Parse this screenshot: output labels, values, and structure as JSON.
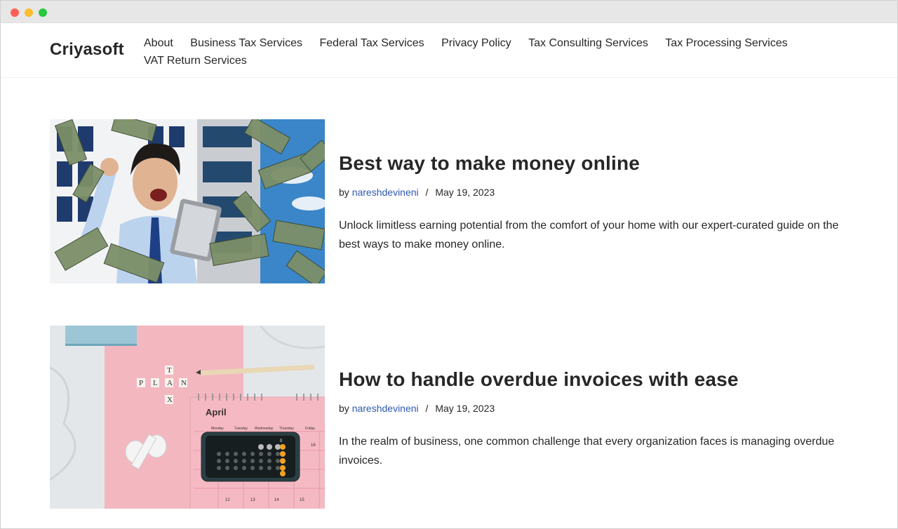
{
  "site": {
    "name": "Criyasoft"
  },
  "nav": {
    "items": [
      {
        "label": "About"
      },
      {
        "label": "Business Tax Services"
      },
      {
        "label": "Federal Tax Services"
      },
      {
        "label": "Privacy Policy"
      },
      {
        "label": "Tax Consulting Services"
      },
      {
        "label": "Tax Processing Services"
      },
      {
        "label": "VAT Return Services"
      }
    ]
  },
  "posts": [
    {
      "title": "Best way to make money online",
      "by": "by",
      "author": "nareshdevineni",
      "separator": "/",
      "date": "May 19, 2023",
      "excerpt": "Unlock limitless earning potential from the comfort of your home with our expert-curated guide on the best ways to make money online."
    },
    {
      "title": "How to handle overdue invoices with ease",
      "by": "by",
      "author": "nareshdevineni",
      "separator": "/",
      "date": "May 19, 2023",
      "excerpt": "In the realm of business, one common challenge that every organization faces is managing overdue invoices.",
      "image_text": {
        "month": "April",
        "days": [
          "Monday",
          "Tuesday",
          "Wednesday",
          "Thursday",
          "Friday"
        ],
        "letters": [
          "P",
          "L",
          "A",
          "N",
          "T",
          "X"
        ],
        "numbers": [
          "0",
          "12",
          "13",
          "14",
          "15",
          "16"
        ]
      }
    }
  ],
  "colors": {
    "link": "#2f5aae",
    "text": "#272727",
    "pink": "#f3b7c0",
    "sky": "#3a86c8"
  }
}
